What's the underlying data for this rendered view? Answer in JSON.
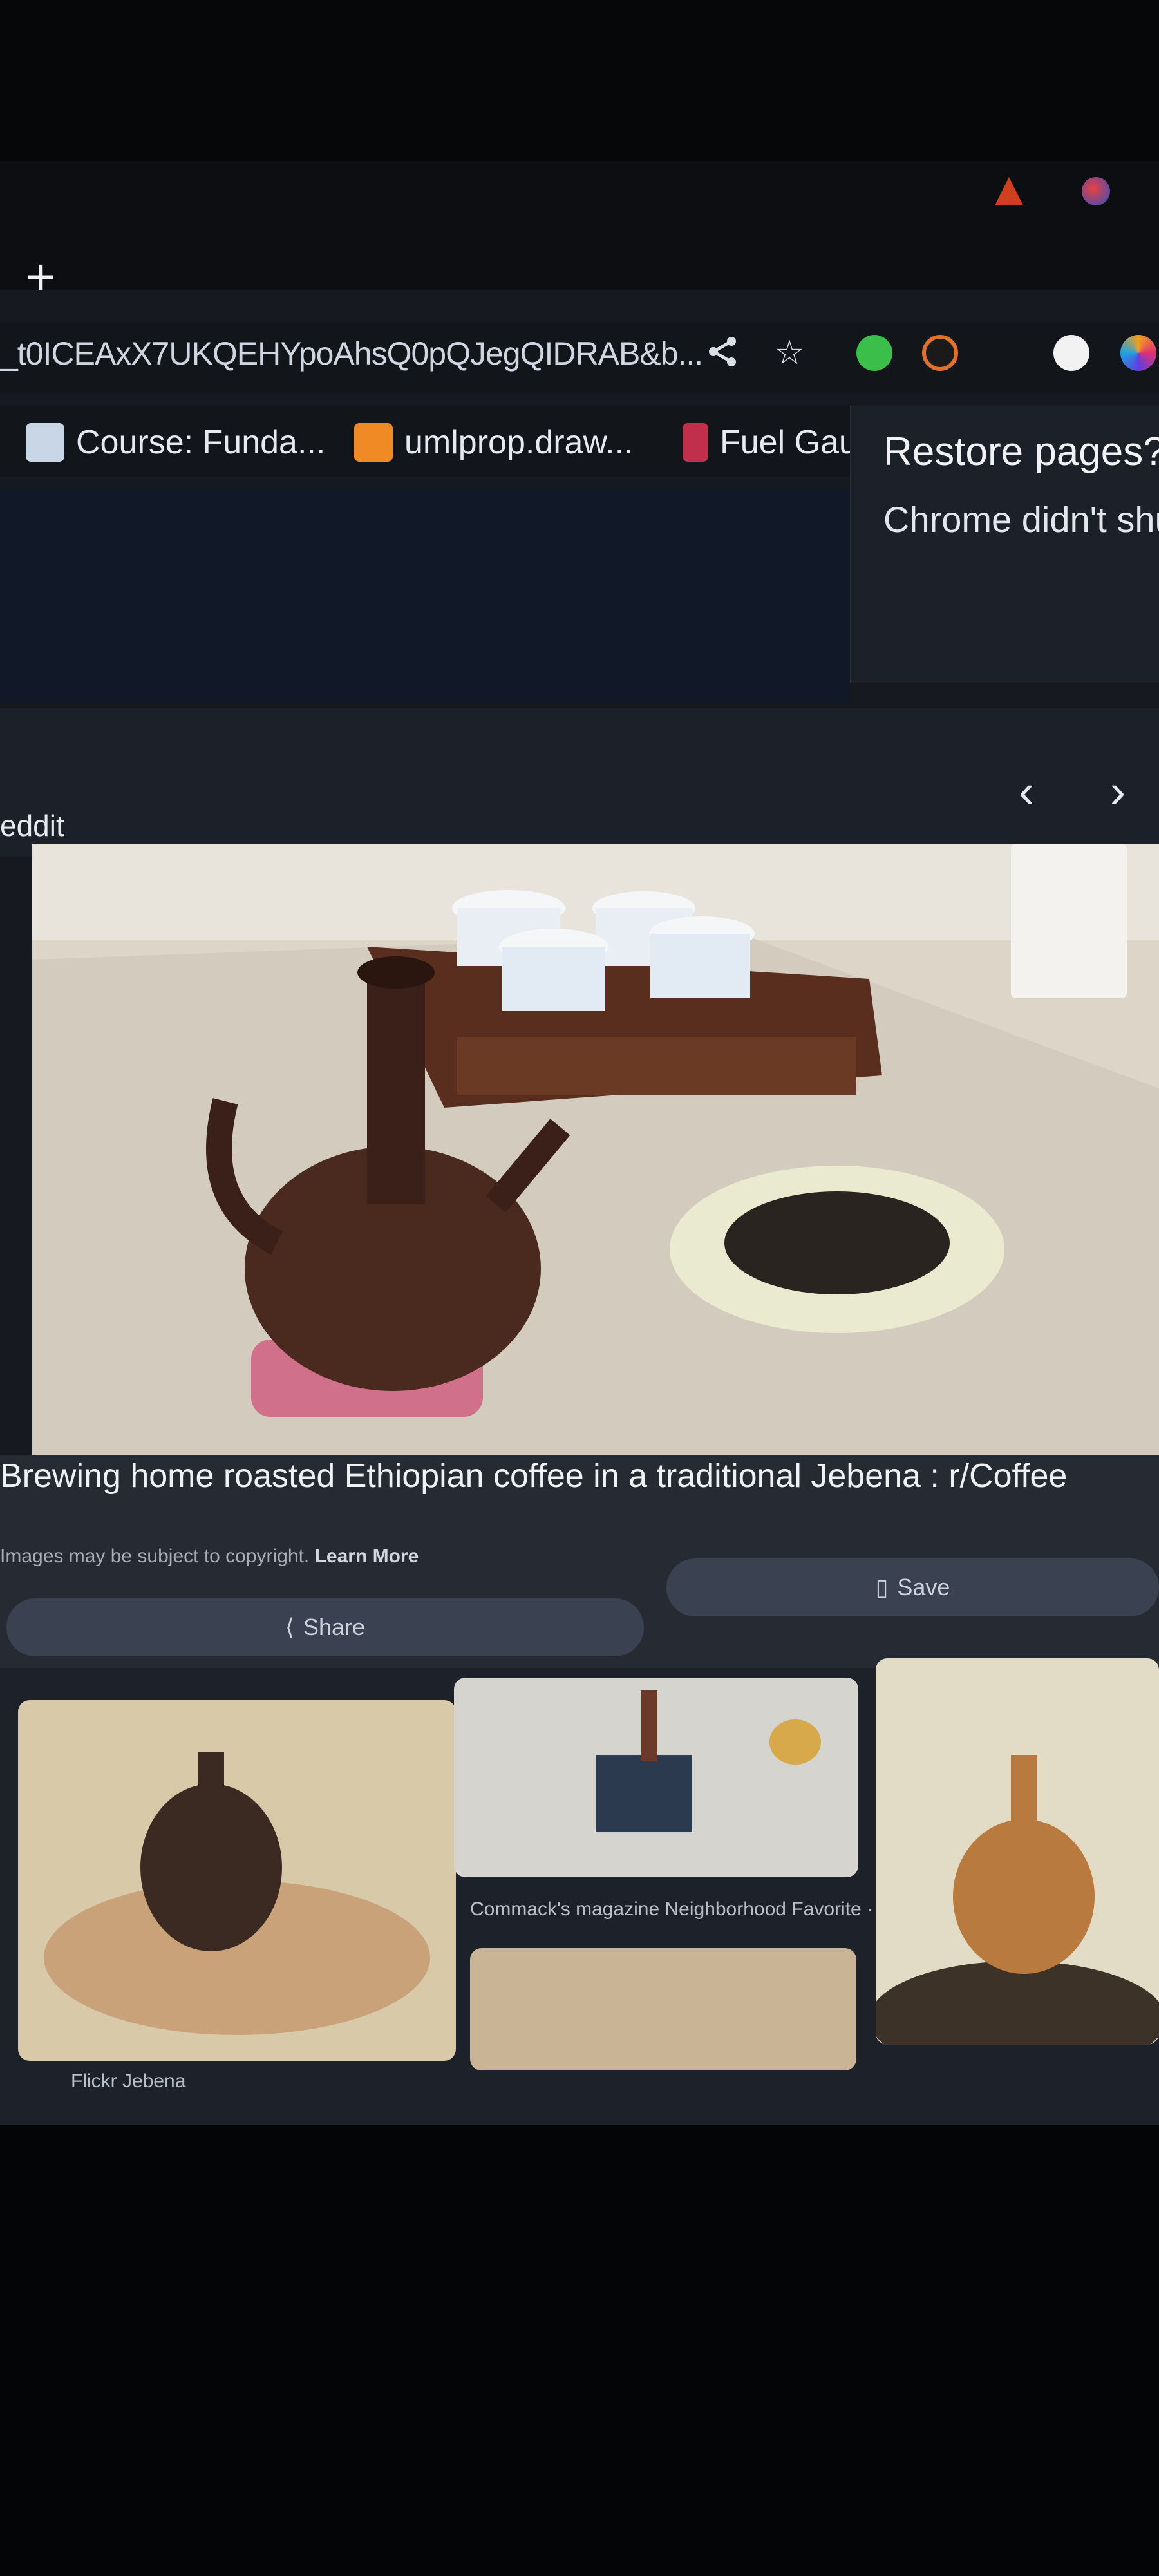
{
  "browser": {
    "url": "_t0ICEAxX7UKQEHYpoAhsQ0pQJegQIDRAB&b...",
    "new_tab_symbol": "+",
    "toolbar_icons": [
      "share-icon",
      "star-icon"
    ],
    "extension_icons": [
      "green-extension-icon",
      "orange-extension-icon",
      "m-extension-icon",
      "gradient-extension-icon"
    ],
    "bookmarks": [
      {
        "label": "Course: Funda...",
        "icon": "course-favicon"
      },
      {
        "label": "umlprop.draw...",
        "icon": "drawio-favicon"
      },
      {
        "label": "Fuel Gau",
        "icon": "fuel-favicon"
      }
    ]
  },
  "restore_popup": {
    "title": "Restore pages?",
    "body": "Chrome didn't shut"
  },
  "viewer": {
    "source": "eddit",
    "prev_symbol": "‹",
    "next_symbol": "›",
    "caption": "Brewing home roasted Ethiopian coffee in a traditional Jebena : r/Coffee",
    "copyright_text": "Images may be subject to copyright.",
    "learn_more": "Learn More",
    "share_label": "Share",
    "save_label": "Save"
  },
  "related": [
    {
      "label": "Flickr   Jebena"
    },
    {
      "label": "Commack's magazine   Neighborhood Favorite · Kind Roast..."
    },
    {
      "label": ""
    }
  ],
  "colors": {
    "accent": "#3a4150",
    "background": "#16191f"
  }
}
